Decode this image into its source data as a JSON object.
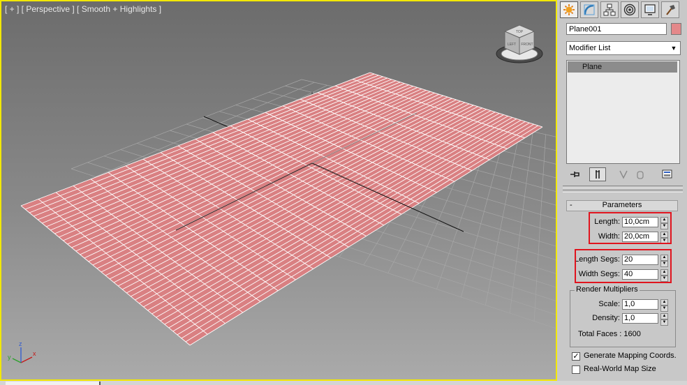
{
  "viewport": {
    "label": "[ + ] [ Perspective ] [ Smooth + Highlights ]",
    "viewcube_faces": {
      "top": "TOP",
      "left": "LEFT",
      "right": "FRONT"
    },
    "axis_labels": {
      "x": "x",
      "y": "y",
      "z": "z"
    }
  },
  "command_panel": {
    "tabs": [
      {
        "icon": "create-icon",
        "active": true
      },
      {
        "icon": "modify-icon",
        "active": false
      },
      {
        "icon": "hierarchy-icon",
        "active": false
      },
      {
        "icon": "motion-icon",
        "active": false
      },
      {
        "icon": "display-icon",
        "active": false
      },
      {
        "icon": "utilities-icon",
        "active": false
      }
    ],
    "object_name": "Plane001",
    "object_color": "#e4888a",
    "modifier_list": "Modifier List",
    "modifier_stack": [
      "Plane"
    ],
    "parameters": {
      "title": "Parameters",
      "length_label": "Length:",
      "length_value": "10,0cm",
      "width_label": "Width:",
      "width_value": "20,0cm",
      "length_segs_label": "Length Segs:",
      "length_segs_value": "20",
      "width_segs_label": "Width Segs:",
      "width_segs_value": "40",
      "render_multipliers_title": "Render Multipliers",
      "scale_label": "Scale:",
      "scale_value": "1,0",
      "density_label": "Density:",
      "density_value": "1,0",
      "total_faces": "Total Faces : 1600",
      "generate_mapping_label": "Generate Mapping Coords.",
      "generate_mapping_checked": true,
      "real_world_label": "Real-World Map Size",
      "real_world_checked": false
    },
    "highlight_color": "#e0141e"
  },
  "scene": {
    "plane_color": "#d98082",
    "plane_segments": {
      "length": 20,
      "width": 40
    }
  }
}
